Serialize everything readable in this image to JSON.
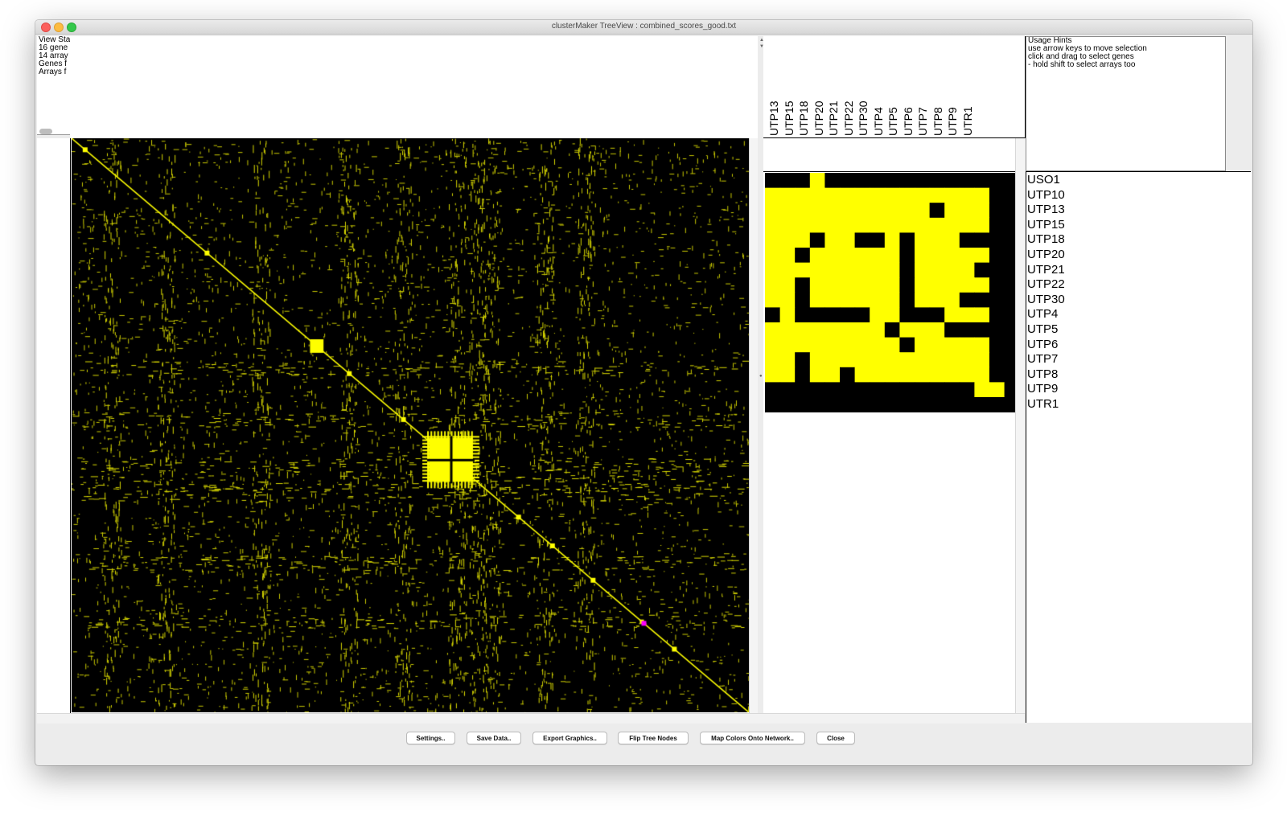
{
  "window": {
    "title": "clusterMaker TreeView : combined_scores_good.txt"
  },
  "status_panel": {
    "lines": [
      "View Sta",
      "16 gene",
      "14 array",
      "Genes f",
      "Arrays f"
    ]
  },
  "usage_hints": {
    "title": "Usage Hints",
    "lines": [
      "use arrow keys to move selection",
      "click and drag to select genes",
      "- hold shift to select arrays too"
    ]
  },
  "column_labels": [
    "UTP13",
    "UTP15",
    "UTP18",
    "UTP20",
    "UTP21",
    "UTP22",
    "UTP30",
    "UTP4",
    "UTP5",
    "UTP6",
    "UTP7",
    "UTP8",
    "UTP9",
    "UTR1"
  ],
  "row_labels": [
    "USO1",
    "UTP10",
    "UTP13",
    "UTP15",
    "UTP18",
    "UTP20",
    "UTP21",
    "UTP22",
    "UTP30",
    "UTP4",
    "UTP5",
    "UTP6",
    "UTP7",
    "UTP8",
    "UTP9",
    "UTR1"
  ],
  "buttons": {
    "settings": "Settings..",
    "save_data": "Save Data..",
    "export_graphics": "Export Graphics..",
    "flip_tree": "Flip Tree Nodes",
    "map_colors": "Map Colors Onto Network..",
    "close": "Close"
  },
  "colors": {
    "high": "#ffff00",
    "low": "#000000",
    "selection": "#ff00ff"
  },
  "chart_data": [
    {
      "type": "heatmap",
      "name": "zoom-view",
      "rows": [
        "USO1",
        "UTP10",
        "UTP13",
        "UTP15",
        "UTP18",
        "UTP20",
        "UTP21",
        "UTP22",
        "UTP30",
        "UTP4",
        "UTP5",
        "UTP6",
        "UTP7",
        "UTP8",
        "UTP9",
        "UTR1"
      ],
      "columns": [
        "",
        "",
        "",
        "UTP13",
        "UTP15",
        "UTP18",
        "UTP20",
        "UTP21",
        "UTP22",
        "UTP30",
        "UTP4",
        "UTP5",
        "UTP6",
        "UTP7",
        "UTP8",
        "UTP9",
        "UTR1"
      ],
      "cells": [
        "00030000000000000",
        "11111111111111100",
        "11111111111011100",
        "11111111111111100",
        "11101100101110000",
        "11011111101111100",
        "11111111101111000",
        "11011111101111100",
        "11011111101110000",
        "01000001100011100",
        "11111111011100000",
        "11111111101111100",
        "11011111111111100",
        "11011011111111100",
        "00000000000000120",
        "00000000000000000"
      ],
      "legend": {
        "0": "low",
        "1": "high",
        "2": "high",
        "3": "high"
      }
    },
    {
      "type": "heatmap",
      "name": "global-view",
      "description_values": {
        "diagonal": "high",
        "background": "low"
      },
      "highlighted_blocks": [
        {
          "row_fraction": 0.362,
          "size_fraction": 0.02
        },
        {
          "row_fraction": 0.56,
          "size_fraction": 0.065
        },
        {
          "row_fraction": 0.842,
          "size_fraction": 0.006
        }
      ]
    }
  ]
}
